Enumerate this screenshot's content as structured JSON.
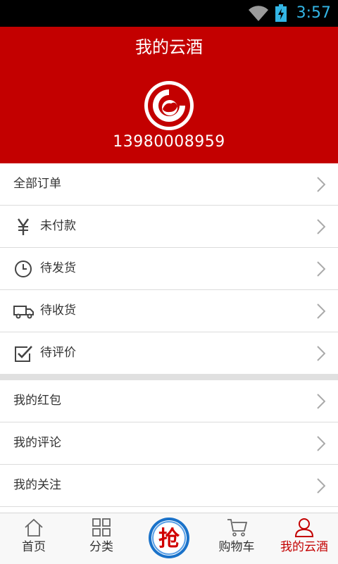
{
  "status_bar": {
    "time": "3:57",
    "wifi_icon": "wifi-icon",
    "battery_icon": "battery-charging-icon",
    "time_color": "#33b5e5"
  },
  "header": {
    "title": "我的云酒",
    "phone": "13980008959",
    "background_color": "#c30000",
    "logo_icon": "yunjiu-logo-icon"
  },
  "orders_section": {
    "items": [
      {
        "label": "全部订单",
        "icon": null
      },
      {
        "label": "未付款",
        "icon": "yen-icon"
      },
      {
        "label": "待发货",
        "icon": "clock-icon"
      },
      {
        "label": "待收货",
        "icon": "truck-icon"
      },
      {
        "label": "待评价",
        "icon": "check-edit-icon"
      }
    ]
  },
  "account_section": {
    "items": [
      {
        "label": "我的红包"
      },
      {
        "label": "我的评论"
      },
      {
        "label": "我的关注"
      }
    ]
  },
  "bottom_nav": {
    "items": [
      {
        "label": "首页",
        "icon": "home-icon"
      },
      {
        "label": "分类",
        "icon": "grid-icon"
      },
      {
        "label": "",
        "icon": "grab-icon",
        "text": "抢"
      },
      {
        "label": "购物车",
        "icon": "cart-icon"
      },
      {
        "label": "我的云酒",
        "icon": "user-icon",
        "active": true
      }
    ],
    "active_color": "#c30000"
  }
}
